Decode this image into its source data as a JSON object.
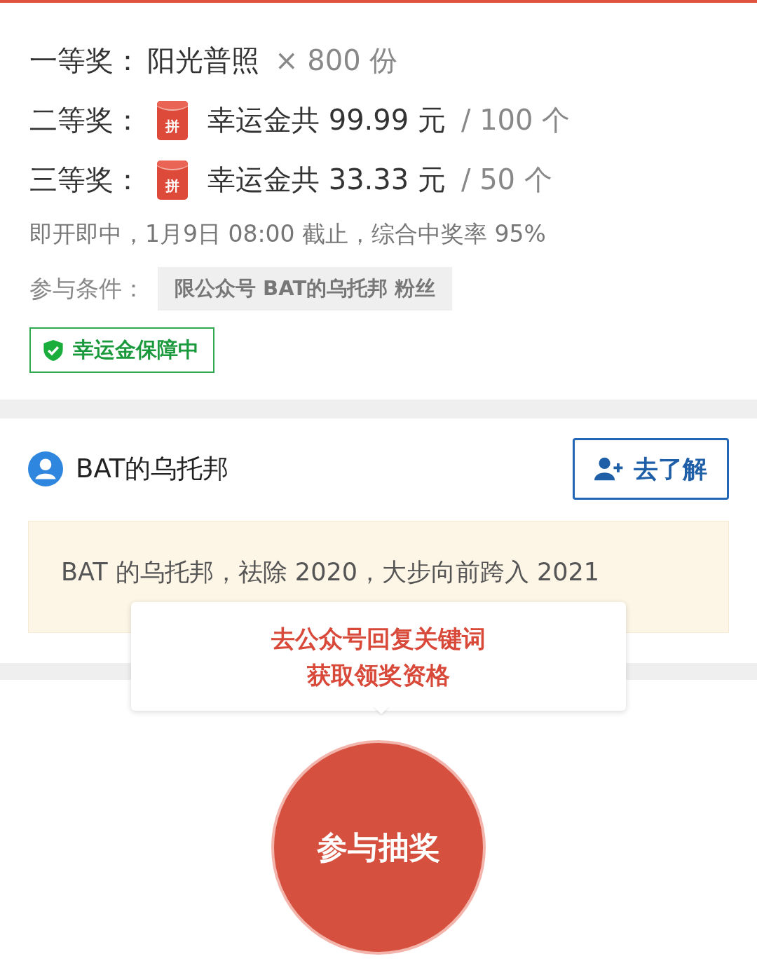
{
  "prizes": [
    {
      "kind": "plain",
      "label": "一等奖：",
      "name": "阳光普照",
      "quantity": "× 800 份"
    },
    {
      "kind": "red_packet",
      "label": "二等奖：",
      "icon_text": "拼",
      "name": "幸运金共 99.99 元",
      "quantity": "/ 100 个"
    },
    {
      "kind": "red_packet",
      "label": "三等奖：",
      "icon_text": "拼",
      "name": "幸运金共 33.33 元",
      "quantity": "/ 50 个"
    }
  ],
  "info": "即开即中，1月9日 08:00 截止，综合中奖率 95%",
  "condition": {
    "label": "参与条件：",
    "value": "限公众号 BAT的乌托邦 粉丝"
  },
  "guarantee_badge": "幸运金保障中",
  "account": {
    "name": "BAT的乌托邦",
    "button": "去了解"
  },
  "notice": "BAT 的乌托邦，祛除 2020，大步向前跨入 2021",
  "tooltip": {
    "lines": [
      "去公众号回复关键词",
      "获取领奖资格"
    ]
  },
  "draw_button": "参与抽奖"
}
